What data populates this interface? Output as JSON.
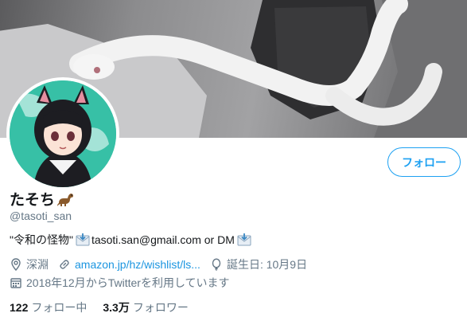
{
  "profile": {
    "display_name": "たそち",
    "handle": "@tasoti_san",
    "follow_label": "フォロー",
    "bio": {
      "prefix": "\"令和の怪物\" ",
      "email": "tasoti.san@gmail.com or DM"
    },
    "location": "深淵",
    "website": "amazon.jp/hz/wishlist/ls...",
    "birthday": "誕生日: 10月9日",
    "joined": "2018年12月からTwitterを利用しています",
    "following_count": "122",
    "following_label": "フォロー中",
    "followers_count": "3.3万",
    "followers_label": "フォロワー"
  },
  "colors": {
    "accent": "#1da1f2",
    "link": "#1b95e0",
    "secondary_text": "#657786",
    "avatar_bg": "#37c0a6"
  },
  "icons": [
    "location-pin-icon",
    "link-icon",
    "balloon-icon",
    "calendar-icon",
    "envelope-icon",
    "dinosaur-emoji"
  ]
}
